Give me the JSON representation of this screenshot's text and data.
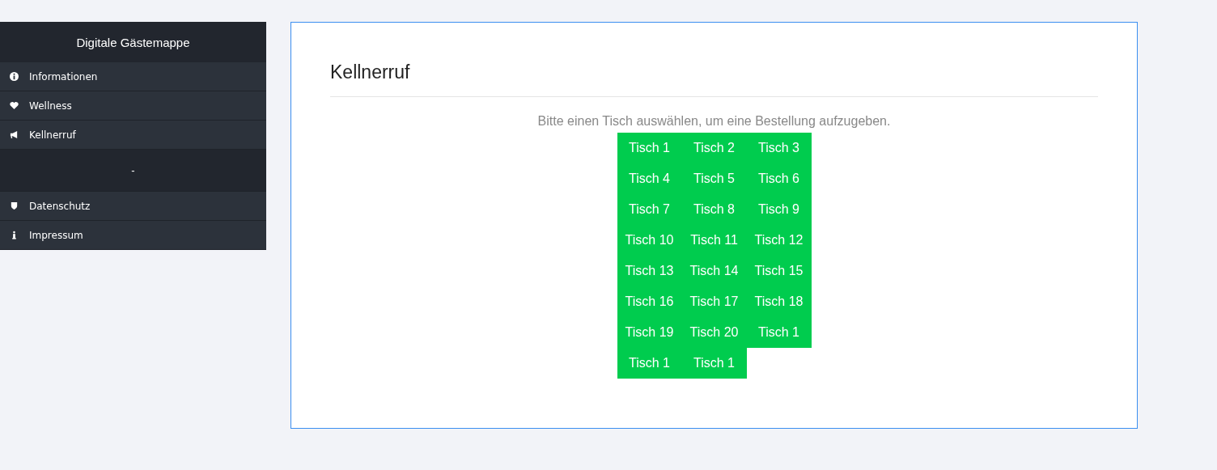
{
  "sidebar": {
    "title": "Digitale Gästemappe",
    "items": [
      {
        "label": "Informationen"
      },
      {
        "label": "Wellness"
      },
      {
        "label": "Kellnerruf",
        "children": [
          {
            "label": "-"
          }
        ]
      },
      {
        "label": "Datenschutz"
      },
      {
        "label": "Impressum"
      }
    ]
  },
  "main": {
    "title": "Kellnerruf",
    "instruction": "Bitte einen Tisch auswählen, um eine Bestellung aufzugeben.",
    "tables": [
      "Tisch 1",
      "Tisch 2",
      "Tisch 3",
      "Tisch 4",
      "Tisch 5",
      "Tisch 6",
      "Tisch 7",
      "Tisch 8",
      "Tisch 9",
      "Tisch 10",
      "Tisch 11",
      "Tisch 12",
      "Tisch 13",
      "Tisch 14",
      "Tisch 15",
      "Tisch 16",
      "Tisch 17",
      "Tisch 18",
      "Tisch 19",
      "Tisch 20",
      "Tisch 1",
      "Tisch 1",
      "Tisch 1"
    ]
  }
}
